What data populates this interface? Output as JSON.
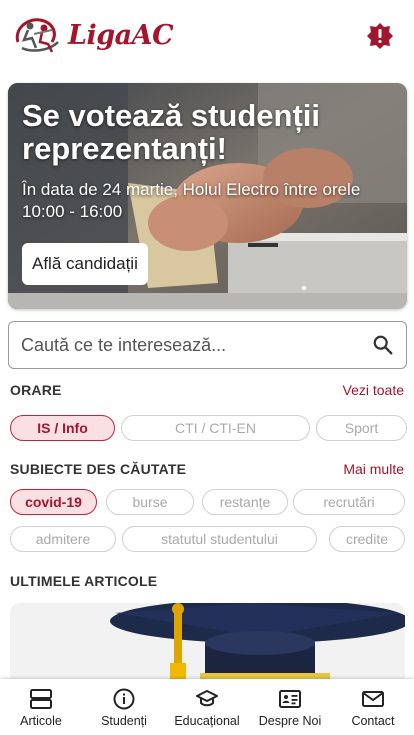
{
  "header": {
    "logo_text": "LigaAC",
    "alert_icon": "alert-octagon-icon",
    "accent_color": "#a3152b"
  },
  "hero": {
    "title": "Se votează studenții reprezentanți!",
    "subtitle": "În data de 24 martie, Holul Electro între orele 10:00 - 16:00",
    "button_label": "Află candidații"
  },
  "search": {
    "placeholder": "Caută ce te interesează...",
    "icon": "search-icon"
  },
  "schedules": {
    "title": "ORARE",
    "link": "Vezi toate",
    "chips": [
      {
        "label": "IS / Info",
        "active": true
      },
      {
        "label": "CTI / CTI-EN",
        "active": false
      },
      {
        "label": "Sport",
        "active": false
      }
    ]
  },
  "topics": {
    "title": "SUBIECTE DES CĂUTATE",
    "link": "Mai multe",
    "chips": [
      {
        "label": "covid-19",
        "active": true
      },
      {
        "label": "burse",
        "active": false
      },
      {
        "label": "restanțe",
        "active": false
      },
      {
        "label": "recrutări",
        "active": false
      },
      {
        "label": "admitere",
        "active": false
      },
      {
        "label": "statutul studentului",
        "active": false
      },
      {
        "label": "credite",
        "active": false
      }
    ]
  },
  "articles": {
    "title": "ULTIMELE ARTICOLE"
  },
  "bottom_nav": [
    {
      "label": "Articole",
      "icon": "articles-icon"
    },
    {
      "label": "Studenți",
      "icon": "info-icon"
    },
    {
      "label": "Educațional",
      "icon": "graduation-cap-icon"
    },
    {
      "label": "Despre Noi",
      "icon": "id-card-icon"
    },
    {
      "label": "Contact",
      "icon": "mail-icon"
    }
  ]
}
